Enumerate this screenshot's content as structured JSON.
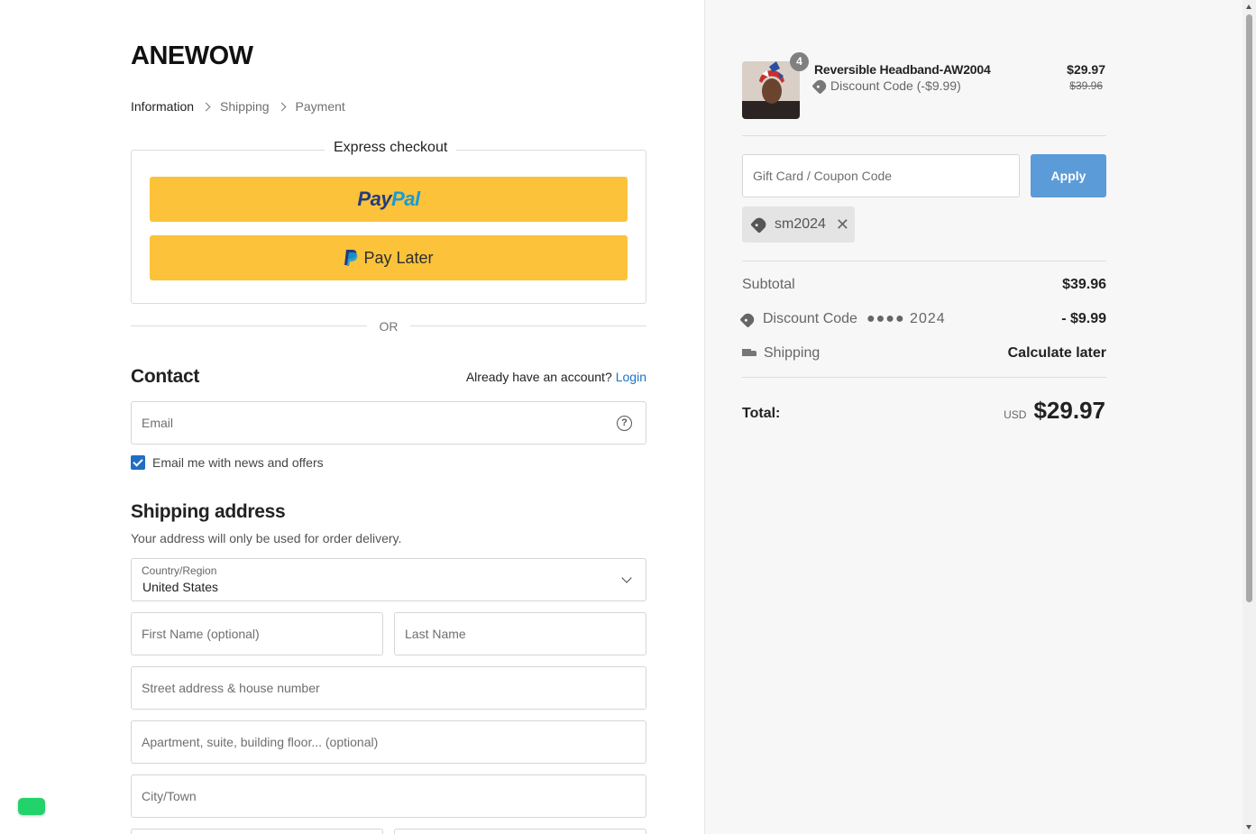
{
  "brand": "ANEWOW",
  "breadcrumb": [
    "Information",
    "Shipping",
    "Payment"
  ],
  "express": {
    "title": "Express checkout",
    "paypal_a": "Pay",
    "paypal_b": "Pal",
    "paylater": "Pay Later",
    "or": "OR"
  },
  "contact": {
    "heading": "Contact",
    "account_prompt": "Already have an account?",
    "login": "Login",
    "email_placeholder": "Email",
    "news_label": "Email me with news and offers",
    "news_checked": true
  },
  "shipping": {
    "heading": "Shipping address",
    "subtext": "Your address will only be used for order delivery.",
    "country_label": "Country/Region",
    "country_value": "United States",
    "first_name": "First Name (optional)",
    "last_name": "Last Name",
    "street": "Street address & house number",
    "apartment": "Apartment, suite, building floor... (optional)",
    "city": "City/Town"
  },
  "summary": {
    "item": {
      "name": "Reversible Headband-AW2004",
      "quantity": "4",
      "discount": "Discount Code (-$9.99)",
      "price": "$29.97",
      "original_price": "$39.96"
    },
    "coupon_placeholder": "Gift Card / Coupon Code",
    "apply": "Apply",
    "applied_code": "sm2024",
    "subtotal_label": "Subtotal",
    "subtotal": "$39.96",
    "discount_label": "Discount Code",
    "discount_masked": "●●●● 2024",
    "discount_value": "- $9.99",
    "shipping_label": "Shipping",
    "shipping_value": "Calculate later",
    "total_label": "Total:",
    "currency": "USD",
    "total": "$29.97"
  },
  "colors": {
    "paypal_yellow": "#fbc23a",
    "apply_blue": "#5b9bd8",
    "link_blue": "#1a73c8",
    "checkbox_blue": "#1f6fc2",
    "chat_green": "#22d36b"
  }
}
